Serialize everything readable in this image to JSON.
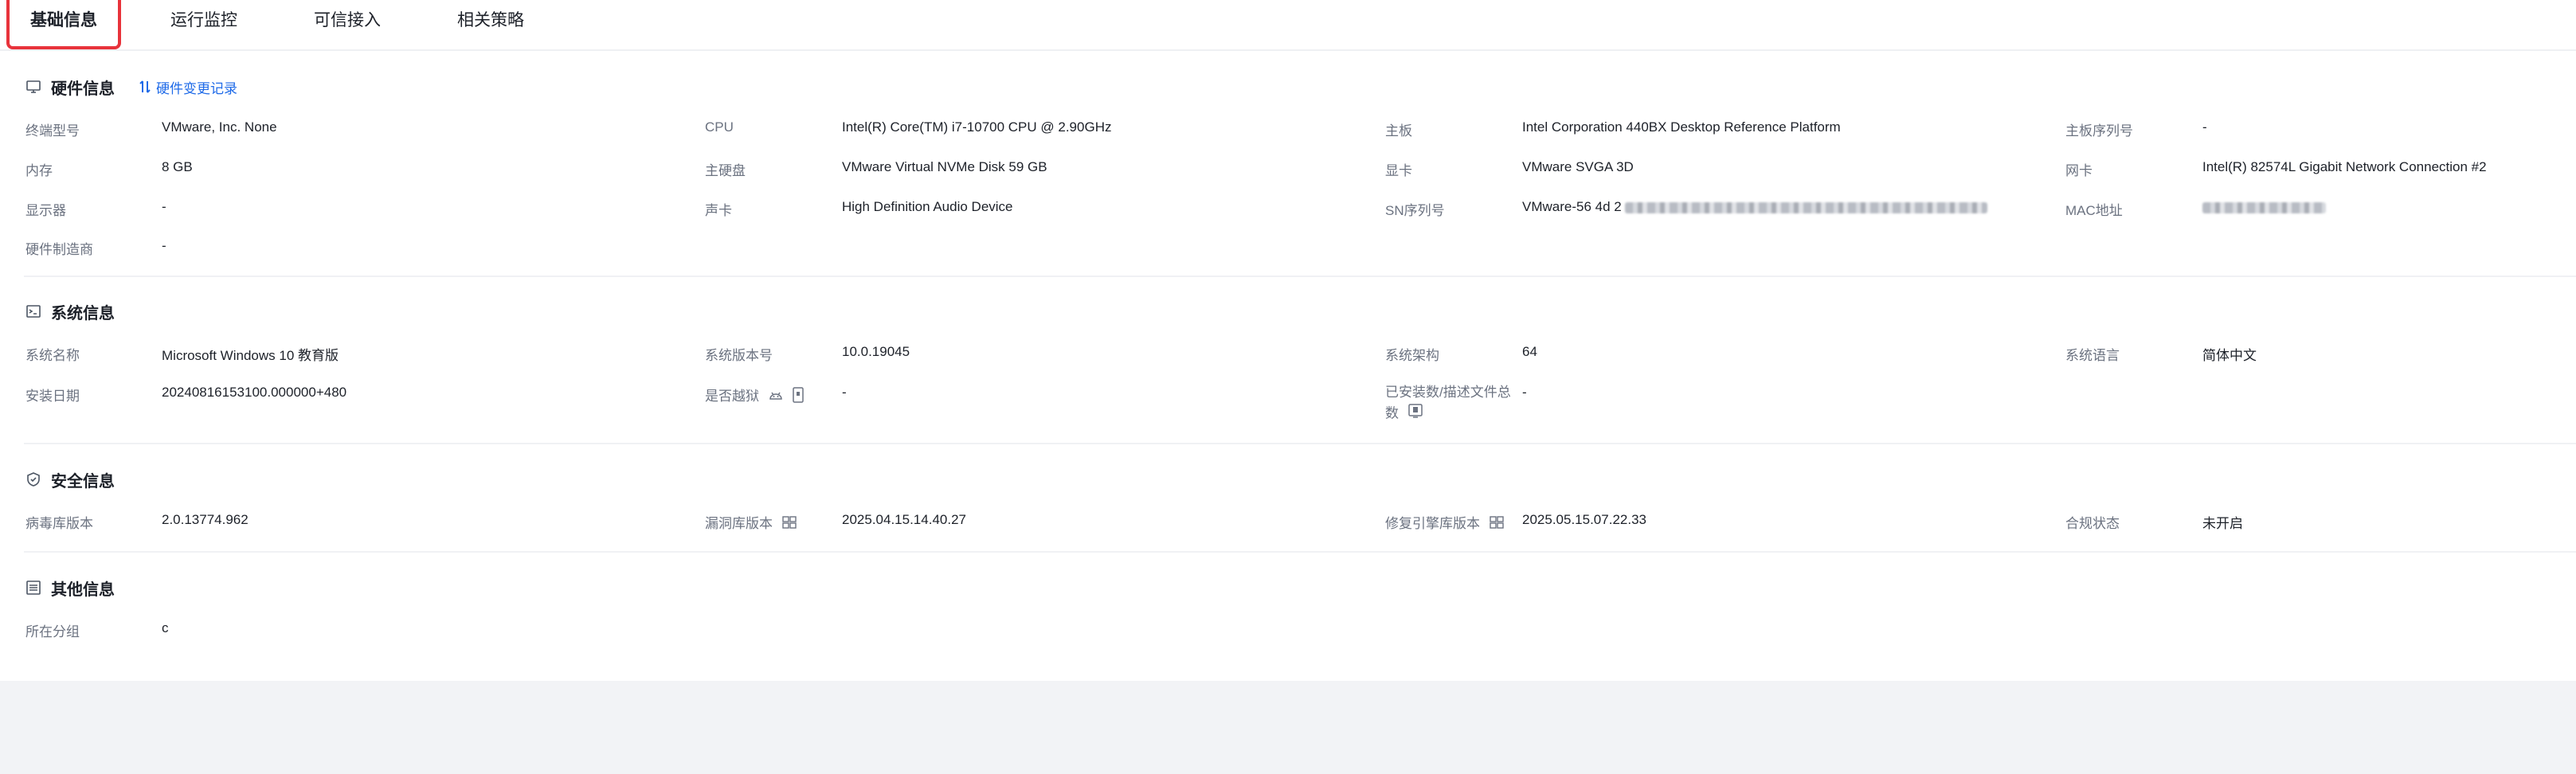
{
  "tabs": [
    {
      "label": "基础信息",
      "active": true
    },
    {
      "label": "运行监控",
      "active": false
    },
    {
      "label": "可信接入",
      "active": false
    },
    {
      "label": "相关策略",
      "active": false
    }
  ],
  "colors": {
    "accent": "#1e6ae8",
    "highlight": "#e8333b",
    "page_bg": "#f2f3f6"
  },
  "hardware": {
    "title": "硬件信息",
    "icon": "monitor-icon",
    "link_label": "硬件变更记录",
    "terminal_model_label": "终端型号",
    "terminal_model": "VMware, Inc. None",
    "cpu_label": "CPU",
    "cpu": "Intel(R) Core(TM) i7-10700 CPU @ 2.90GHz",
    "motherboard_label": "主板",
    "motherboard": "Intel Corporation 440BX Desktop Reference Platform",
    "mb_serial_label": "主板序列号",
    "mb_serial": "-",
    "memory_label": "内存",
    "memory": "8 GB",
    "disk_label": "主硬盘",
    "disk": "VMware Virtual NVMe Disk 59 GB",
    "gpu_label": "显卡",
    "gpu": "VMware SVGA 3D",
    "nic_label": "网卡",
    "nic": "Intel(R) 82574L Gigabit Network Connection #2",
    "display_label": "显示器",
    "display": "-",
    "sound_label": "声卡",
    "sound": "High Definition Audio Device",
    "sn_label": "SN序列号",
    "sn_prefix": "VMware-56 4d 2",
    "mac_label": "MAC地址",
    "manufacturer_label": "硬件制造商",
    "manufacturer": "-"
  },
  "system": {
    "title": "系统信息",
    "icon": "terminal-icon",
    "os_name_label": "系统名称",
    "os_name": "Microsoft Windows 10 教育版",
    "os_version_label": "系统版本号",
    "os_version": "10.0.19045",
    "arch_label": "系统架构",
    "arch": "64",
    "lang_label": "系统语言",
    "lang": "简体中文",
    "install_date_label": "安装日期",
    "install_date": "20240816153100.000000+480",
    "jailbreak_label": "是否越狱",
    "jailbreak": "-",
    "installed_label": "已安装数/描述文件总数",
    "installed": "-"
  },
  "security": {
    "title": "安全信息",
    "icon": "shield-icon",
    "virus_db_label": "病毒库版本",
    "virus_db": "2.0.13774.962",
    "vuln_db_label": "漏洞库版本",
    "vuln_db": "2025.04.15.14.40.27",
    "repair_engine_label": "修复引擎库版本",
    "repair_engine": "2025.05.15.07.22.33",
    "compliance_label": "合规状态",
    "compliance": "未开启"
  },
  "other": {
    "title": "其他信息",
    "icon": "list-icon",
    "group_label": "所在分组",
    "group": "c"
  }
}
